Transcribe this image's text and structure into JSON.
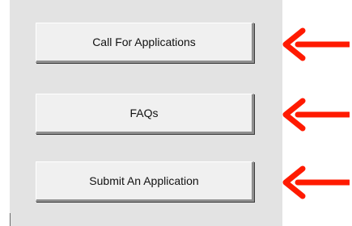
{
  "buttons": {
    "call_for_applications": "Call For Applications",
    "faqs": "FAQs",
    "submit_application": "Submit An Application"
  },
  "colors": {
    "panel": "#e3e3e3",
    "button_face": "#f0f0f0",
    "arrow": "#ff1a00"
  },
  "icons": {
    "arrow": "left-arrow-icon"
  }
}
